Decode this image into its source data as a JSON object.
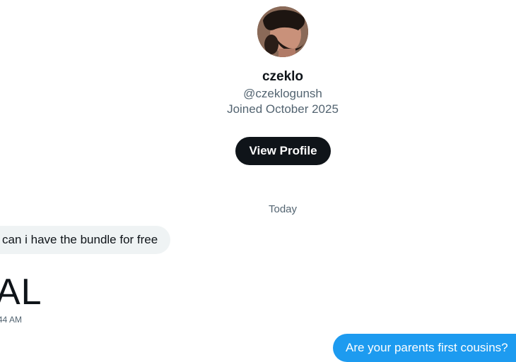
{
  "profile": {
    "display_name": "czeklo",
    "handle": "@czeklogunsh",
    "joined": "Joined October 2025",
    "view_profile_label": "View Profile"
  },
  "conversation": {
    "date_separator": "Today",
    "messages": [
      {
        "direction": "incoming",
        "text": "can i have the bundle for free"
      },
      {
        "direction": "incoming",
        "text": "AL",
        "time": "44 AM"
      },
      {
        "direction": "outgoing",
        "text": "Are your parents first cousins?"
      }
    ]
  },
  "colors": {
    "primary_text": "#0f1419",
    "secondary_text": "#536471",
    "incoming_bubble": "#eff3f4",
    "outgoing_bubble": "#1d9bf0",
    "button_bg": "#0f1419"
  }
}
